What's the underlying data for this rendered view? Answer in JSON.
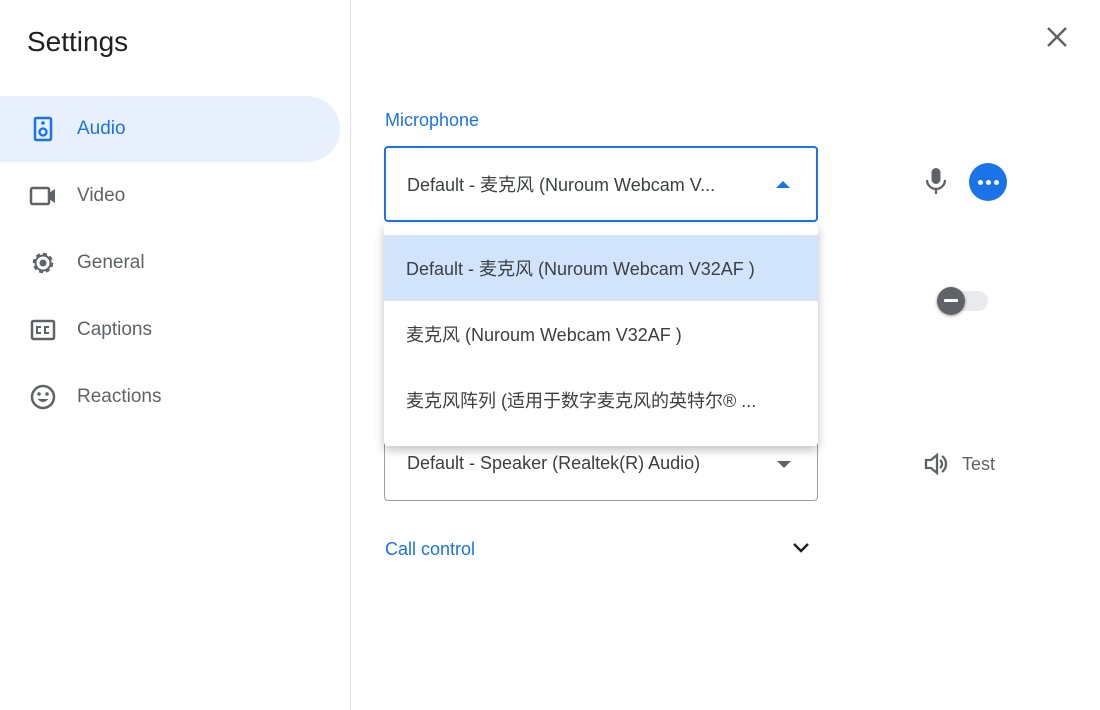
{
  "title": "Settings",
  "sidebar": {
    "items": [
      {
        "label": "Audio",
        "icon": "speaker-icon",
        "active": true
      },
      {
        "label": "Video",
        "icon": "videocam-icon"
      },
      {
        "label": "General",
        "icon": "gear-icon"
      },
      {
        "label": "Captions",
        "icon": "closed-captions-icon"
      },
      {
        "label": "Reactions",
        "icon": "smiley-icon"
      }
    ]
  },
  "microphone": {
    "label": "Microphone",
    "selected": "Default - 麦克风 (Nuroum Webcam V...",
    "options": [
      "Default - 麦克风 (Nuroum Webcam V32AF )",
      "麦克风 (Nuroum Webcam V32AF )",
      "麦克风阵列 (适用于数字麦克风的英特尔® ..."
    ]
  },
  "speaker": {
    "selected": "Default - Speaker (Realtek(R) Audio)",
    "test_label": "Test"
  },
  "call_control": {
    "label": "Call control"
  },
  "colors": {
    "accent": "#1a73e8",
    "active_bg": "#e8f0fe",
    "selected_option": "#d2e3fc"
  }
}
